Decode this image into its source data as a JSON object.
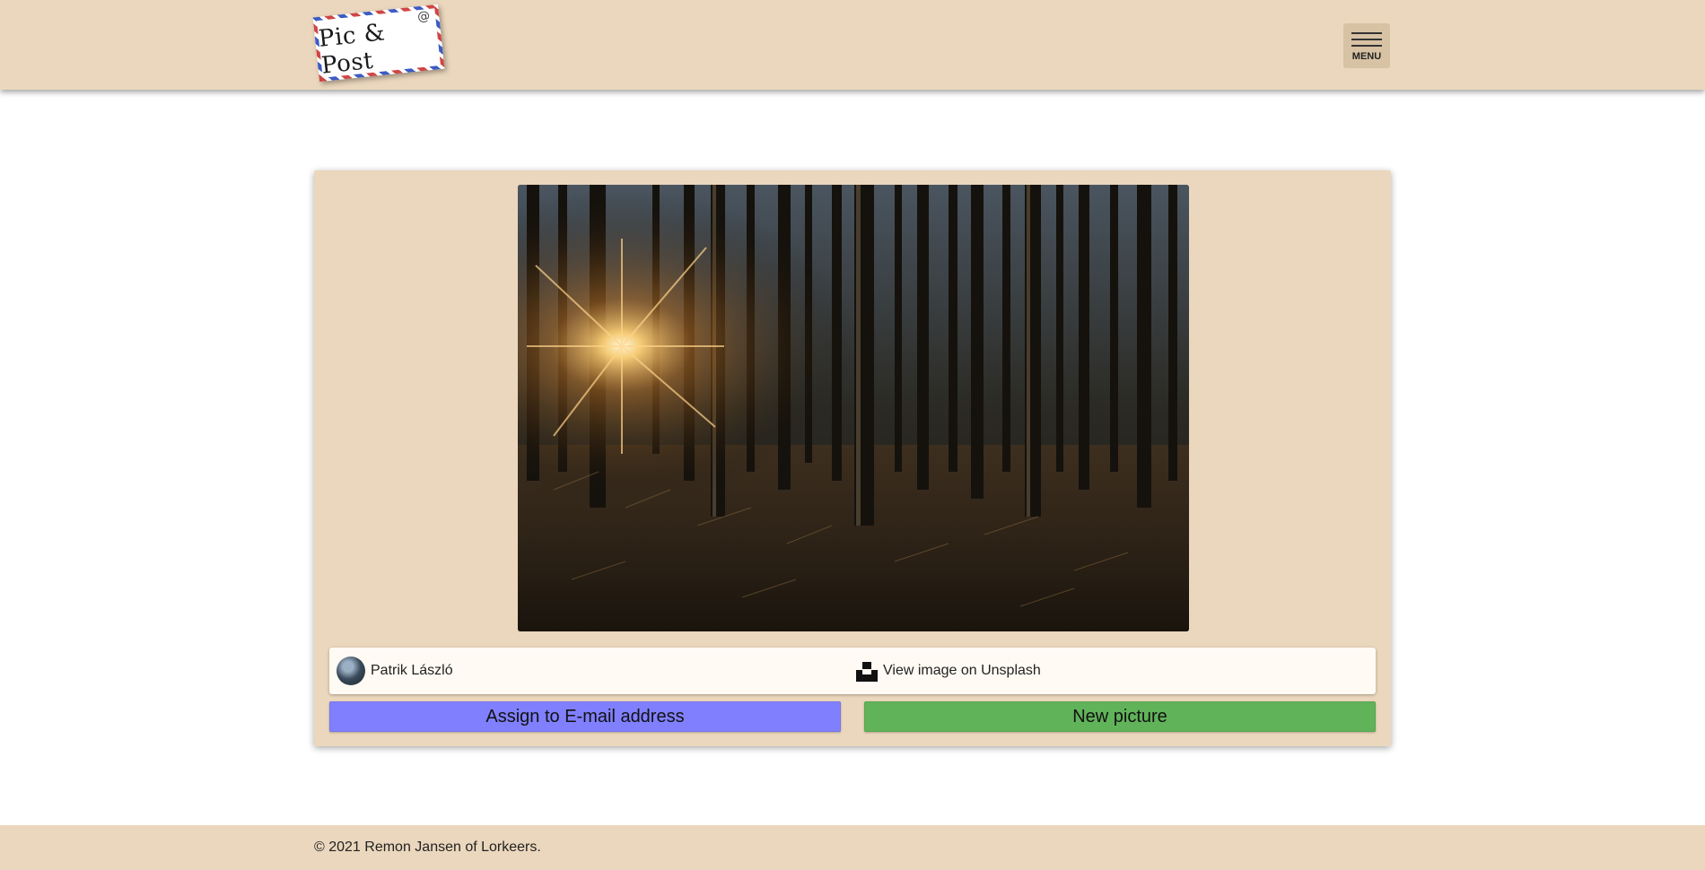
{
  "header": {
    "logo_text": "Pic & Post",
    "logo_at": "@",
    "menu_label": "MENU"
  },
  "photo": {
    "description_icon": "forest-sunrise-photo"
  },
  "credit": {
    "author_name": "Patrik László",
    "unsplash_link": "View image on Unsplash",
    "unsplash_icon": "unsplash-icon"
  },
  "actions": {
    "assign_label": "Assign to E-mail address",
    "new_picture_label": "New picture"
  },
  "footer": {
    "copyright": "© 2021 Remon Jansen of Lorkeers."
  },
  "colors": {
    "header_bg": "#ebd7bd",
    "card_bg": "#ebd7bd",
    "assign_btn": "#8080ff",
    "new_btn": "#61b35a",
    "credit_bg": "#fffaf3"
  }
}
